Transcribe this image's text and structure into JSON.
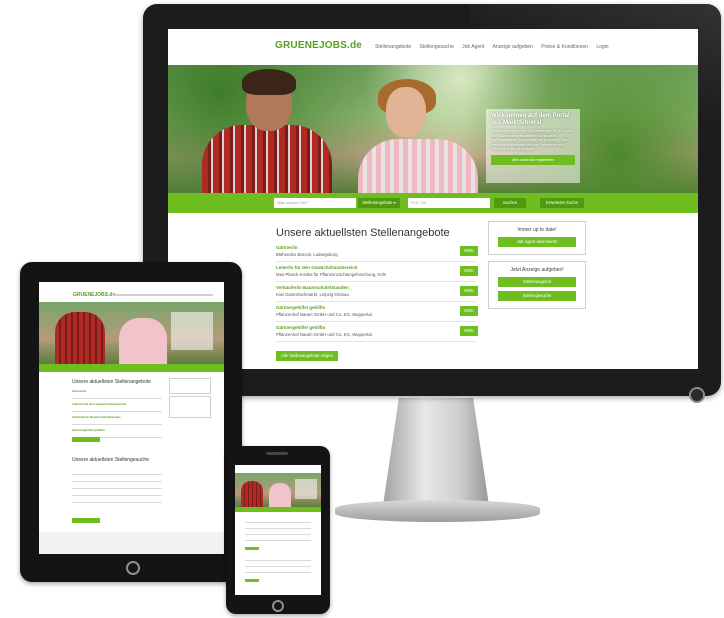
{
  "site": {
    "logo": "GRUENEJOBS.de",
    "nav": [
      "Stellenangebote",
      "Stellengesuche",
      "Job Agent",
      "Anzeige aufgeben",
      "Preise & Konditionen",
      "Login"
    ]
  },
  "hero": {
    "welcome_title": "Willkommen auf dem Portal des Marktführers!",
    "welcome_text": "Profitieren Sie von der Reichweite der TASPO und ihrer Schwesterzeitschriften. Nur aktuelle Stellenangebote, keiner älter als 4 Wochen. Jetzt kostenlos registrieren und alle Funktionen von GRUENEJOBS.de nutzen!",
    "welcome_button": "Jetzt kostenlos registrieren"
  },
  "search": {
    "keyword_placeholder": "Was suchen Sie?",
    "category": "Stellenangebote",
    "location_placeholder": "PLZ, Ort",
    "submit": "Suchen",
    "advanced": "Erweiterte Suche"
  },
  "main": {
    "title": "Unsere aktuellsten Stellenangebote",
    "more_label": "Mehr",
    "all_button": "Alle Stellenangebote zeigen",
    "jobs": [
      {
        "title": "Gärtner/in",
        "company": "Blühendes Barock, Ludwigsburg"
      },
      {
        "title": "Leiter/in für den Gewächshausbereich",
        "company": "Max-Planck-Institut für Pflanzenzüchtungsforschung, Köln"
      },
      {
        "title": "Verkäufer/in Baumschule/Stauden",
        "company": "Kiwi Gartenfachmarkt, Leipzig-Grünau"
      },
      {
        "title": "Gärtnergehilfe/ gehilfin",
        "company": "Pflanzenhof Nauen GmbH und Co. KG, Wuppertal"
      },
      {
        "title": "Gärtnergehilfe/ gehilfin",
        "company": "Pflanzenhof Nauen GmbH und Co. KG, Wuppertal"
      }
    ]
  },
  "sidebar": {
    "update_title": "Immer up to date!",
    "update_button": "Job Agent abonnieren",
    "ad_title": "Jetzt Anzeige aufgeben!",
    "ad_buttons": [
      "Stellenangebot",
      "Stellengesuche"
    ]
  },
  "tablet": {
    "section1_title": "Unsere aktuellsten Stellenangebote",
    "section2_title": "Unsere aktuellsten Stellengesuche"
  },
  "colors": {
    "brand_green": "#6dbe1e",
    "dark_green": "#5a9e1e",
    "device_frame": "#1c1c1c"
  }
}
